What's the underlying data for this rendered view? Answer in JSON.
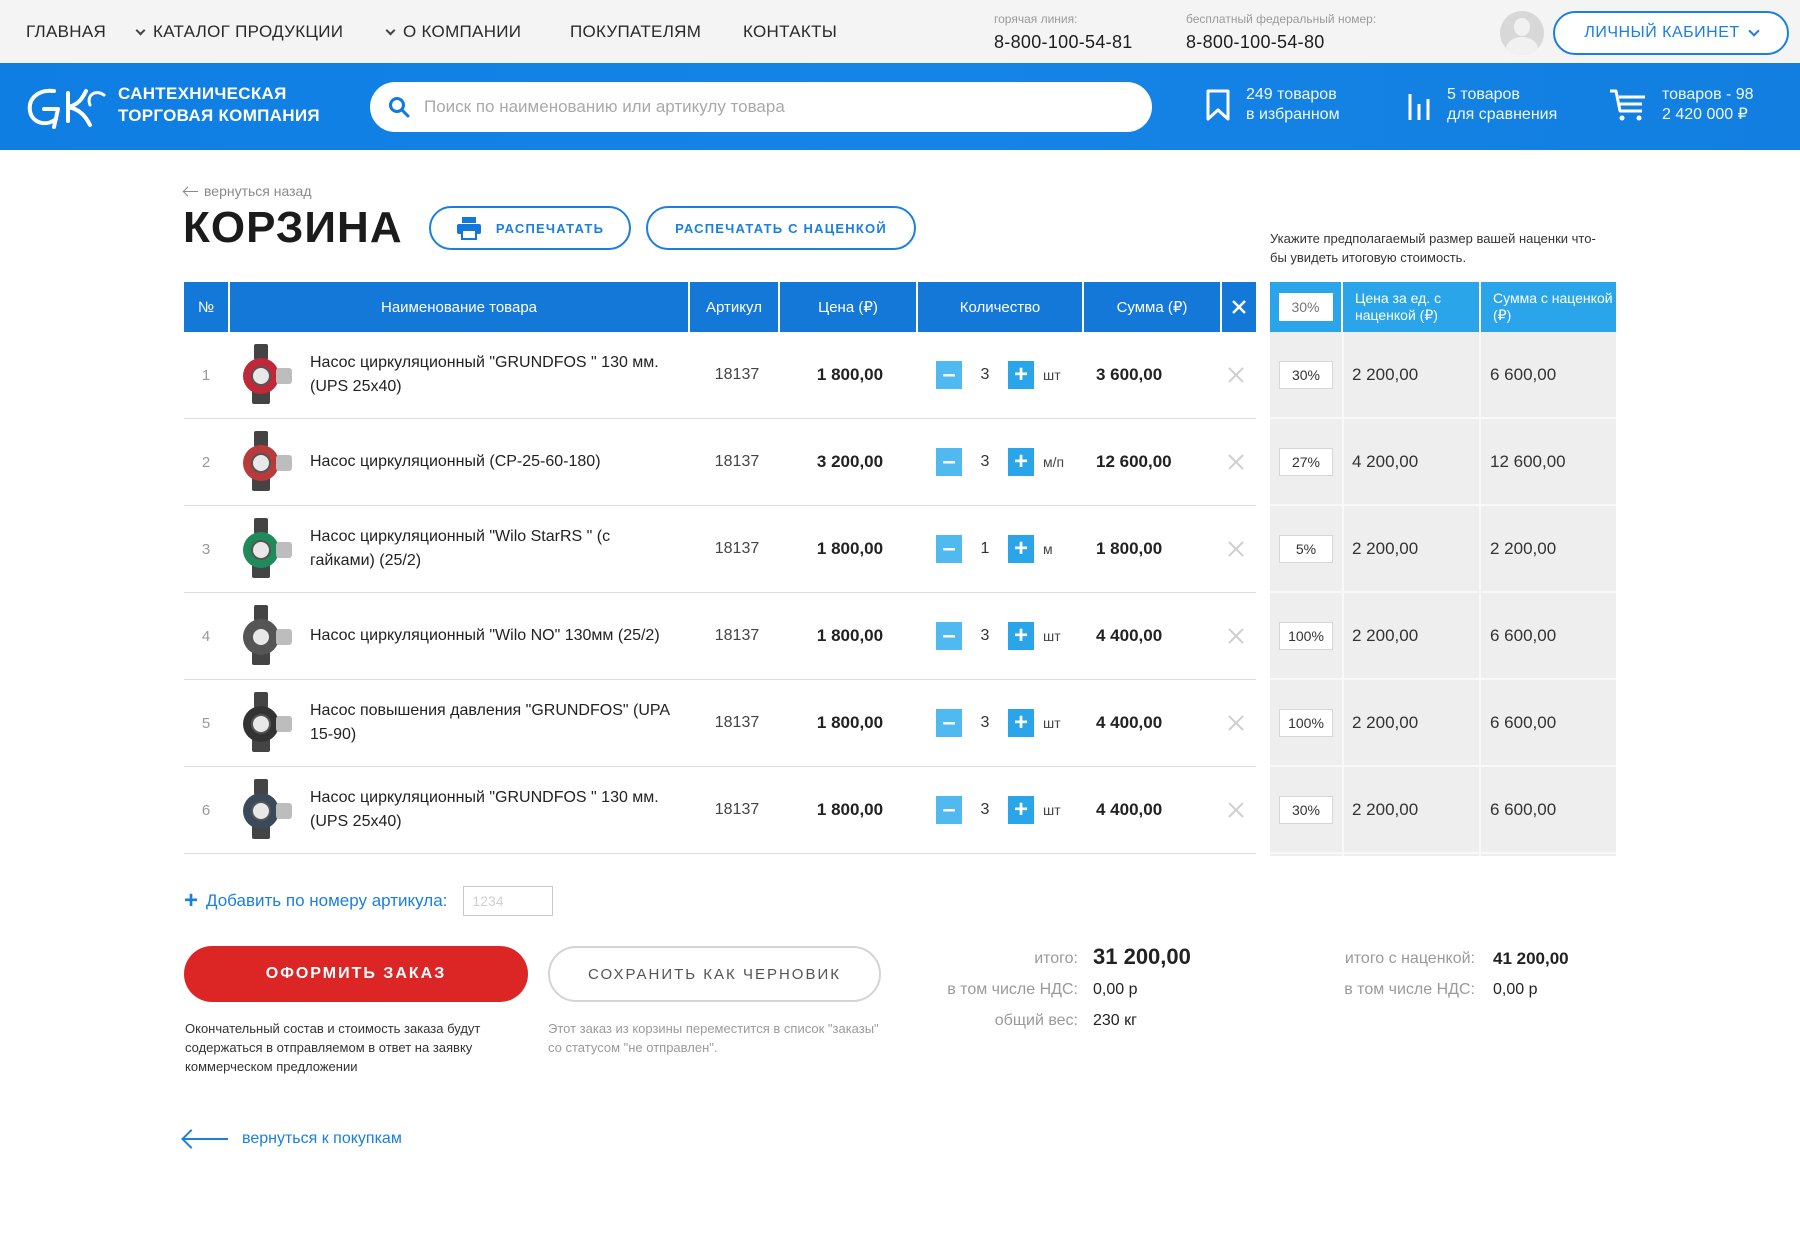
{
  "topnav": {
    "items": [
      "ГЛАВНАЯ",
      "КАТАЛОГ ПРОДУКЦИИ",
      "О КОМПАНИИ",
      "ПОКУПАТЕЛЯМ",
      "КОНТАКТЫ"
    ],
    "hotline_caption": "горячая линия:",
    "hotline_number": "8-800-100-54-81",
    "federal_caption": "бесплатный федеральный номер:",
    "federal_number": "8-800-100-54-80",
    "cabinet_label": "ЛИЧНЫЙ КАБИНЕТ"
  },
  "header": {
    "brand_line1": "САНТЕХНИЧЕСКАЯ",
    "brand_line2": "ТОРГОВАЯ КОМПАНИЯ",
    "search_placeholder": "Поиск по наименованию или артикулу товара",
    "favorites_line1": "249 товаров",
    "favorites_line2": "в избранном",
    "compare_line1": "5 товаров",
    "compare_line2": "для сравнения",
    "cart_line1": "товаров - 98",
    "cart_line2": "2 420 000 ₽",
    "icons": [
      "search-icon",
      "bookmark-icon",
      "compare-icon",
      "cart-icon"
    ]
  },
  "page": {
    "back_label": "вернуться назад",
    "title": "КОРЗИНА",
    "print_label": "РАСПЕЧАТАТЬ",
    "print_markup_label": "РАСПЕЧАТАТЬ С НАЦЕНКОЙ",
    "markup_hint": "Укажите предполагаемый размер вашей наценки что-бы увидеть итоговую стоимость."
  },
  "table": {
    "headers": {
      "num": "№",
      "name": "Наименование товара",
      "article": "Артикул",
      "price": "Цена (₽)",
      "qty": "Количество",
      "sum": "Сумма (₽)"
    },
    "rows": [
      {
        "num": "1",
        "name": "Насос циркуляционный \"GRUNDFOS \" 130 мм. (UPS 25х40)",
        "article": "18137",
        "price": "1 800,00",
        "qty": "3",
        "unit": "шт",
        "sum": "3 600,00",
        "img_color": "#c0283a"
      },
      {
        "num": "2",
        "name": "Насос циркуляционный (CP-25-60-180)",
        "article": "18137",
        "price": "3 200,00",
        "qty": "3",
        "unit": "м/п",
        "sum": "12 600,00",
        "img_color": "#b83a3a"
      },
      {
        "num": "3",
        "name": "Насос циркуляционный \"Wilo StarRS \" (с гайками) (25/2)",
        "article": "18137",
        "price": "1 800,00",
        "qty": "1",
        "unit": "м",
        "sum": "1 800,00",
        "img_color": "#1f8a5a"
      },
      {
        "num": "4",
        "name": "Насос циркуляционный \"Wilo NO\" 130мм (25/2)",
        "article": "18137",
        "price": "1 800,00",
        "qty": "3",
        "unit": "шт",
        "sum": "4 400,00",
        "img_color": "#555555"
      },
      {
        "num": "5",
        "name": "Насос повышения давления \"GRUNDFOS\" (UPA 15-90)",
        "article": "18137",
        "price": "1 800,00",
        "qty": "3",
        "unit": "шт",
        "sum": "4 400,00",
        "img_color": "#333333"
      },
      {
        "num": "6",
        "name": "Насос циркуляционный \"GRUNDFOS \" 130 мм. (UPS 25х40)",
        "article": "18137",
        "price": "1 800,00",
        "qty": "3",
        "unit": "шт",
        "sum": "4 400,00",
        "img_color": "#3a4a5a"
      }
    ]
  },
  "markup": {
    "header_percent_placeholder": "30%",
    "header_unit_price": "Цена за ед. с наценкой (₽)",
    "header_sum": "Сумма с наценкой (₽)",
    "rows": [
      {
        "percent": "30%",
        "unit_price": "2 200,00",
        "sum": "6 600,00"
      },
      {
        "percent": "27%",
        "unit_price": "4 200,00",
        "sum": "12 600,00"
      },
      {
        "percent": "5%",
        "unit_price": "2 200,00",
        "sum": "2 200,00"
      },
      {
        "percent": "100%",
        "unit_price": "2 200,00",
        "sum": "6 600,00"
      },
      {
        "percent": "100%",
        "unit_price": "2 200,00",
        "sum": "6 600,00"
      },
      {
        "percent": "30%",
        "unit_price": "2 200,00",
        "sum": "6 600,00"
      }
    ]
  },
  "add_article": {
    "label": "Добавить по номеру артикула:",
    "placeholder": "1234"
  },
  "actions": {
    "order_label": "ОФОРМИТЬ ЗАКАЗ",
    "draft_label": "СОХРАНИТЬ КАК ЧЕРНОВИК",
    "order_note": "Окончательный состав и стоимость заказа будут содержаться в отправляемом в ответ на заявку коммерческом предложении",
    "draft_note": "Этот заказ из корзины переместится в список \"заказы\" со статусом \"не отправлен\"."
  },
  "totals": {
    "total_label": "итого:",
    "total_value": "31 200,00",
    "vat_label": "в том числе НДС:",
    "vat_value": "0,00 р",
    "weight_label": "общий вес:",
    "weight_value": "230 кг",
    "markup_total_label": "итого с наценкой:",
    "markup_total_value": "41 200,00",
    "markup_vat_label": "в том числе НДС:",
    "markup_vat_value": "0,00 р"
  },
  "footer": {
    "back_to_shop": "вернуться к покупкам"
  },
  "colors": {
    "primary_blue": "#1478d8",
    "light_blue": "#2aa5ea",
    "order_red": "#dc2626"
  }
}
